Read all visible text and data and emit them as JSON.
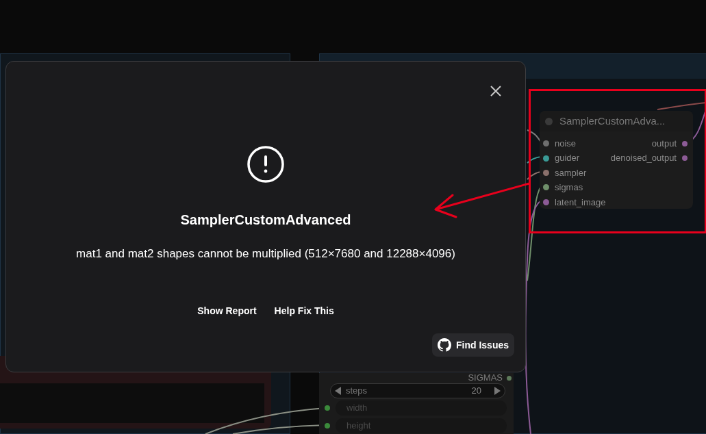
{
  "canvas": {
    "node": {
      "title": "SamplerCustomAdva...",
      "inputs": [
        {
          "label": "noise",
          "color": "#6e6e6e"
        },
        {
          "label": "guider",
          "color": "#3a9a95"
        },
        {
          "label": "sampler",
          "color": "#8a706b"
        },
        {
          "label": "sigmas",
          "color": "#6f8f6a"
        },
        {
          "label": "latent_image",
          "color": "#8c5b96"
        }
      ],
      "outputs": [
        {
          "label": "output",
          "color": "#8c5b96"
        },
        {
          "label": "denoised_output",
          "color": "#8c5b96"
        }
      ]
    },
    "lower_node": {
      "output": {
        "label": "SIGMAS",
        "color": "#5d7a5a"
      },
      "steps": {
        "label": "steps",
        "value": "20"
      },
      "inputs": [
        {
          "label": "width",
          "color": "#3b8a3b"
        },
        {
          "label": "height",
          "color": "#3b8a3b"
        }
      ]
    }
  },
  "dialog": {
    "title": "SamplerCustomAdvanced",
    "message": "mat1 and mat2 shapes cannot be multiplied (512×7680 and 12288×4096)",
    "links": [
      "Show Report",
      "Help Fix This"
    ],
    "find_button": "Find Issues"
  }
}
